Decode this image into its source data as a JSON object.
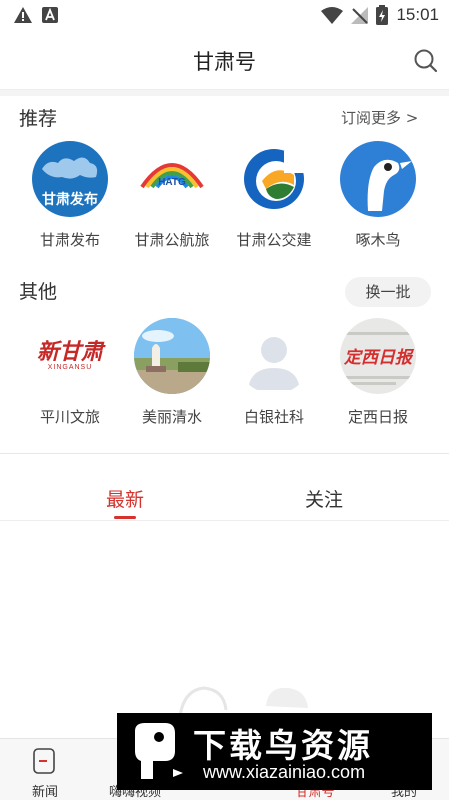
{
  "status": {
    "time": "15:01"
  },
  "header": {
    "title": "甘肃号"
  },
  "recommend": {
    "title": "推荐",
    "more": "订阅更多 >",
    "items": [
      {
        "label": "甘肃发布",
        "logo_text": "甘肃发布"
      },
      {
        "label": "甘肃公航旅",
        "logo_text": "HATG"
      },
      {
        "label": "甘肃公交建"
      },
      {
        "label": "啄木鸟"
      }
    ]
  },
  "others": {
    "title": "其他",
    "swap": "换一批",
    "items": [
      {
        "label": "平川文旅",
        "logo_text": "新甘肃",
        "logo_sub": "XINGANSU"
      },
      {
        "label": "美丽清水"
      },
      {
        "label": "白银社科"
      },
      {
        "label": "定西日报",
        "logo_text": "定西日报"
      }
    ]
  },
  "tabs": [
    {
      "label": "最新",
      "active": true
    },
    {
      "label": "关注",
      "active": false
    }
  ],
  "bottom_nav": [
    {
      "label": "新闻"
    },
    {
      "label": "嗨嗨视频"
    },
    {
      "label": "甘肃号"
    },
    {
      "label": "我的"
    }
  ],
  "ad": {
    "title": "下载鸟资源",
    "url": "www.xiazainiao.com"
  },
  "colors": {
    "accent": "#d4332e",
    "blue": "#1e73be"
  }
}
